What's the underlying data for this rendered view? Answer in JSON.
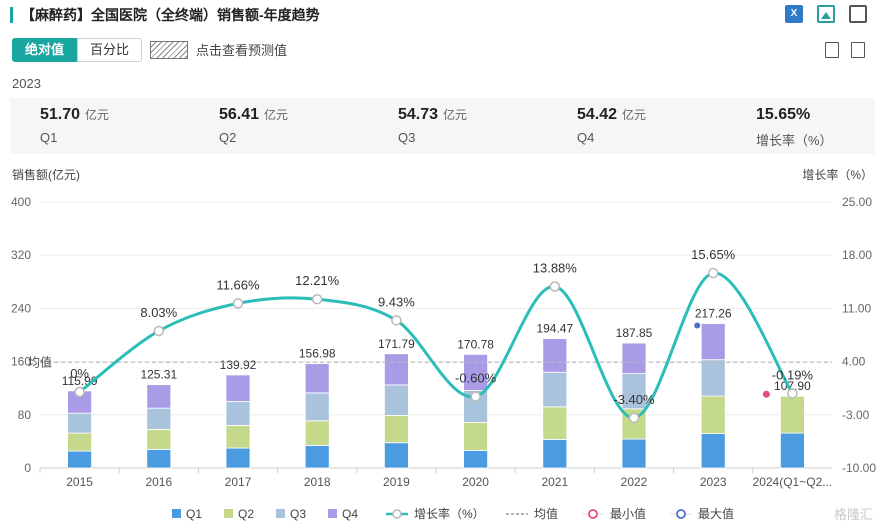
{
  "header": {
    "title": "【麻醉药】全国医院（全终端）销售额-年度趋势",
    "excel_icon_text": "X"
  },
  "tabs": [
    {
      "label": "绝对值"
    },
    {
      "label": "百分比"
    }
  ],
  "predict_label": "点击查看预测值",
  "year": "2023",
  "summary": [
    {
      "value": "51.70",
      "unit": "亿元",
      "label": "Q1"
    },
    {
      "value": "56.41",
      "unit": "亿元",
      "label": "Q2"
    },
    {
      "value": "54.73",
      "unit": "亿元",
      "label": "Q3"
    },
    {
      "value": "54.42",
      "unit": "亿元",
      "label": "Q4"
    },
    {
      "value": "15.65%",
      "unit": "",
      "label": "增长率（%）"
    }
  ],
  "colors": {
    "q1": "#4a9be0",
    "q2": "#c5d98b",
    "q3": "#a9c3dc",
    "q4": "#a99be6",
    "growth": "#2bbdb8",
    "min": "#e84a87",
    "max": "#4c6fd6"
  },
  "watermark": "格隆汇",
  "chart_data": {
    "type": "bar",
    "stacked": true,
    "categories": [
      "2015",
      "2016",
      "2017",
      "2018",
      "2019",
      "2020",
      "2021",
      "2022",
      "2023",
      "2024(Q1~Q2..."
    ],
    "series": [
      {
        "name": "Q1",
        "values": [
          25.5,
          28.0,
          30.0,
          34.0,
          38.0,
          26.5,
          43.0,
          43.5,
          51.7,
          52.5
        ]
      },
      {
        "name": "Q2",
        "values": [
          27.0,
          30.0,
          34.0,
          37.0,
          41.0,
          42.0,
          49.0,
          45.5,
          56.41,
          55.4
        ]
      },
      {
        "name": "Q3",
        "values": [
          30.0,
          32.0,
          36.0,
          42.0,
          46.0,
          48.0,
          52.0,
          53.0,
          54.73,
          0
        ]
      },
      {
        "name": "Q4",
        "values": [
          33.49,
          35.31,
          39.92,
          43.98,
          46.79,
          54.28,
          50.47,
          45.85,
          54.42,
          0
        ]
      }
    ],
    "totals": [
      115.99,
      125.31,
      139.92,
      156.98,
      171.79,
      170.78,
      194.47,
      187.85,
      217.26,
      107.9
    ],
    "total_labels": [
      "115.99",
      "125.31",
      "139.92",
      "156.98",
      "171.79",
      "170.78",
      "194.47",
      "187.85",
      "217.26",
      "107.90"
    ],
    "growth": {
      "name": "增长率（%）",
      "values": [
        0,
        8.03,
        11.66,
        12.21,
        9.43,
        -0.6,
        13.88,
        -3.4,
        15.65,
        -0.19
      ],
      "labels": [
        "0%",
        "8.03%",
        "11.66%",
        "12.21%",
        "9.43%",
        "-0.60%",
        "13.88%",
        "-3.40%",
        "15.65%",
        "-0.19%"
      ]
    },
    "mean": {
      "name": "均值",
      "label": "均值",
      "value": 158.9
    },
    "min_label": "最小值",
    "max_label": "最大值",
    "ylabel": "销售额(亿元)",
    "y2label": "增长率（%）",
    "ylim": [
      0,
      400
    ],
    "yticks": [
      "0",
      "80",
      "160",
      "240",
      "320",
      "400"
    ],
    "y2lim": [
      -10,
      25
    ],
    "y2ticks": [
      "-10.00",
      "-3.00",
      "4.00",
      "11.00",
      "18.00",
      "25.00"
    ],
    "grid": true,
    "legend_position": "bottom"
  }
}
